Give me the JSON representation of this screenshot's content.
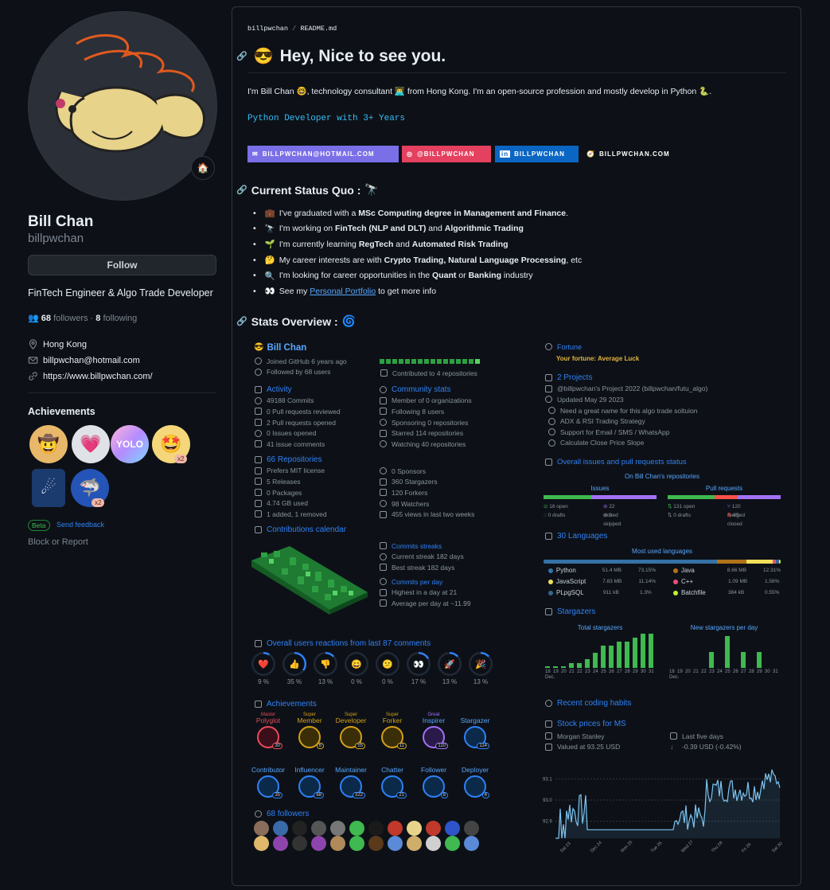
{
  "profile": {
    "name": "Bill Chan",
    "login": "billpwchan",
    "follow_label": "Follow",
    "bio": "FinTech Engineer & Algo Trade Developer",
    "followers_count": "68",
    "followers_word": "followers",
    "following_count": "8",
    "following_word": "following",
    "location": "Hong Kong",
    "email": "billpwchan@hotmail.com",
    "website": "https://www.billpwchan.com/",
    "achievements_title": "Achievements",
    "beta": "Beta",
    "send_feedback": "Send feedback",
    "block": "Block or Report",
    "x2": "x2"
  },
  "readme": {
    "crumb_user": "billpwchan",
    "crumb_file": "README.md",
    "title": "Hey, Nice to see you.",
    "intro": "I'm Bill Chan 🤓, technology consultant 👨‍💻 from Hong Kong. I'm an open-source profession and mostly develop in Python 🐍.",
    "typing": "Python Developer with 3+ Years",
    "shields": [
      "BILLPWCHAN@HOTMAIL.COM",
      "@BILLPWCHAN",
      "BILLPWCHAN",
      "BILLPWCHAN.COM"
    ],
    "status_title": "Current Status Quo :",
    "bullets": [
      {
        "emoji": "💼",
        "pre": "I've graduated with a ",
        "b1": "MSc Computing degree in Management and Finance",
        "mid": ".",
        "b2": "",
        "post": ""
      },
      {
        "emoji": "🔭",
        "pre": "I'm working on ",
        "b1": "FinTech (NLP and DLT)",
        "mid": " and ",
        "b2": "Algorithmic Trading",
        "post": ""
      },
      {
        "emoji": "🌱",
        "pre": "I'm currently learning ",
        "b1": "RegTech",
        "mid": " and ",
        "b2": "Automated Risk Trading",
        "post": ""
      },
      {
        "emoji": "🤔",
        "pre": "My career interests are with ",
        "b1": "Crypto Trading, Natural Language Processing",
        "mid": ", etc",
        "b2": "",
        "post": ""
      },
      {
        "emoji": "🔍",
        "pre": "I'm looking for career opportunities in the ",
        "b1": "Quant",
        "mid": " or ",
        "b2": "Banking",
        "post": " industry"
      },
      {
        "emoji": "👀",
        "pre": "See my ",
        "b1": "Personal Portfolio",
        "mid": " to get more info",
        "b2": "",
        "post": ""
      }
    ],
    "stats_title": "Stats Overview :"
  },
  "metrics": {
    "user": "Bill Chan",
    "joined": "Joined GitHub 6 years ago",
    "followed": "Followed by 68 users",
    "contributed": "Contributed to 4 repositories",
    "activity_title": "Activity",
    "activity": [
      "49188 Commits",
      "0 Pull requests reviewed",
      "2 Pull requests opened",
      "0 Issues opened",
      "41 issue comments"
    ],
    "community_title": "Community stats",
    "community": [
      "Member of 0 organizations",
      "Following 8 users",
      "Sponsoring 0 repositories",
      "Starred 114 repositories",
      "Watching 40 repositories"
    ],
    "repos_title": "66 Repositories",
    "repos": [
      "Prefers MIT license",
      "5 Releases",
      "0 Packages",
      "4.74 GB used",
      "1 added, 1 removed"
    ],
    "repos2": [
      "0 Sponsors",
      "360 Stargazers",
      "120 Forkers",
      "98 Watchers",
      "455 views in last two weeks"
    ],
    "calendar_title": "Contributions calendar",
    "streaks_title": "Commits streaks",
    "streaks": [
      "Current streak 182 days",
      "Best streak 182 days"
    ],
    "perday_title": "Commits per day",
    "perday": [
      "Highest in a day at 21",
      "Average per day at ~11.99"
    ],
    "reactions_title": "Overall users reactions from last 87 comments",
    "reactions": [
      {
        "emoji": "❤️",
        "pct": "9 %",
        "v": 0.09
      },
      {
        "emoji": "👍",
        "pct": "35 %",
        "v": 0.35
      },
      {
        "emoji": "👎",
        "pct": "13 %",
        "v": 0.13
      },
      {
        "emoji": "😄",
        "pct": "0 %",
        "v": 0
      },
      {
        "emoji": "😕",
        "pct": "0 %",
        "v": 0
      },
      {
        "emoji": "👀",
        "pct": "17 %",
        "v": 0.17
      },
      {
        "emoji": "🚀",
        "pct": "13 %",
        "v": 0.13
      },
      {
        "emoji": "🎉",
        "pct": "13 %",
        "v": 0.13
      }
    ],
    "achievements_title": "Achievements",
    "achievements": [
      {
        "sup": "Master",
        "name": "Polyglot",
        "n": "30"
      },
      {
        "sup": "Super",
        "name": "Member",
        "n": "6"
      },
      {
        "sup": "Super",
        "name": "Developer",
        "n": "55"
      },
      {
        "sup": "Super",
        "name": "Forker",
        "n": "11"
      },
      {
        "sup": "Great",
        "name": "Inspirer",
        "n": "110"
      },
      {
        "sup": "",
        "name": "Stargazer",
        "n": "114"
      },
      {
        "sup": "",
        "name": "Contributor",
        "n": "35"
      },
      {
        "sup": "",
        "name": "Influencer",
        "n": "68"
      },
      {
        "sup": "",
        "name": "Maintainer",
        "n": "322"
      },
      {
        "sup": "",
        "name": "Chatter",
        "n": "21"
      },
      {
        "sup": "",
        "name": "Follower",
        "n": "8"
      },
      {
        "sup": "",
        "name": "Deployer",
        "n": "4"
      }
    ],
    "followers_title": "68 followers",
    "fortune_title": "Fortune",
    "fortune": "Your fortune: Average Luck",
    "projects_title": "2 Projects",
    "project_name": "@billpwchan's Project 2022 (billpwchan/futu_algo)",
    "project_updated": "Updated May 29 2023",
    "project_items": [
      "Need a great name for this algo trade soltuion",
      "ADX & RSI Trading Strategy",
      "Support for Email / SMS / WhatsApp",
      "Calculate Close Price Slope"
    ],
    "issues_title": "Overall issues and pull requests status",
    "on_repos": "On Bill Chan's repositories",
    "issues_label": "Issues",
    "prs_label": "Pull requests",
    "issues": [
      "16 open",
      "22 closed",
      "0 drafts",
      "0 skipped"
    ],
    "prs": [
      "131 open",
      "120 merged",
      "0 drafts",
      "65 closed"
    ],
    "languages_title": "30 Languages",
    "most_used": "Most used languages",
    "languages": [
      {
        "name": "Python",
        "size": "51.4 MB",
        "pct": "73.15%",
        "color": "#3572A5"
      },
      {
        "name": "Java",
        "size": "8.66 MB",
        "pct": "12.31%",
        "color": "#b07219"
      },
      {
        "name": "JavaScript",
        "size": "7.83 MB",
        "pct": "11.14%",
        "color": "#f1e05a"
      },
      {
        "name": "C++",
        "size": "1.09 MB",
        "pct": "1.56%",
        "color": "#f34b7d"
      },
      {
        "name": "PLpgSQL",
        "size": "911 kB",
        "pct": "1.3%",
        "color": "#336790"
      },
      {
        "name": "Batchfile",
        "size": "384 kB",
        "pct": "0.55%",
        "color": "#C1F12E"
      }
    ],
    "stargazers_title": "Stargazers",
    "total_stargazers": "Total stargazers",
    "new_stargazers": "New stargazers per day",
    "coding_title": "Recent coding habits",
    "stock_title": "Stock prices for MS",
    "stock_company": "Morgan Stanley",
    "stock_value": "Valued at 93.25 USD",
    "stock_period": "Last five days",
    "stock_change": "-0.39 USD (-0.42%)"
  },
  "chart_data": [
    {
      "type": "bar",
      "title": "Total stargazers",
      "categories": [
        "18 Dec.",
        "19",
        "20",
        "21",
        "22",
        "23",
        "24",
        "25",
        "26",
        "27",
        "28",
        "29",
        "30",
        "31"
      ],
      "values": [
        352,
        352,
        352,
        353,
        353,
        354,
        354,
        356,
        356,
        357,
        357,
        358,
        359,
        359
      ]
    },
    {
      "type": "bar",
      "title": "New stargazers per day",
      "categories": [
        "18 Dec.",
        "19",
        "20",
        "21",
        "22",
        "23",
        "24",
        "25",
        "26",
        "27",
        "28",
        "29",
        "30",
        "31"
      ],
      "values": [
        0,
        0,
        0,
        0,
        0,
        1,
        0,
        2,
        0,
        1,
        0,
        1,
        0,
        0
      ]
    },
    {
      "type": "line",
      "title": "Stock prices for MS",
      "x": [
        "Sat 23",
        "Dec 24",
        "Mon 25",
        "Tue 26",
        "Wed 27",
        "Thu 28",
        "Fri 29",
        "Sat 30"
      ],
      "y_ticks": [
        "93.1",
        "93.0",
        "92.9"
      ],
      "values": [
        92.2,
        93.05,
        92.88,
        92.4,
        92.3,
        92.25,
        92.25,
        92.9,
        93.12,
        93.1
      ]
    }
  ]
}
